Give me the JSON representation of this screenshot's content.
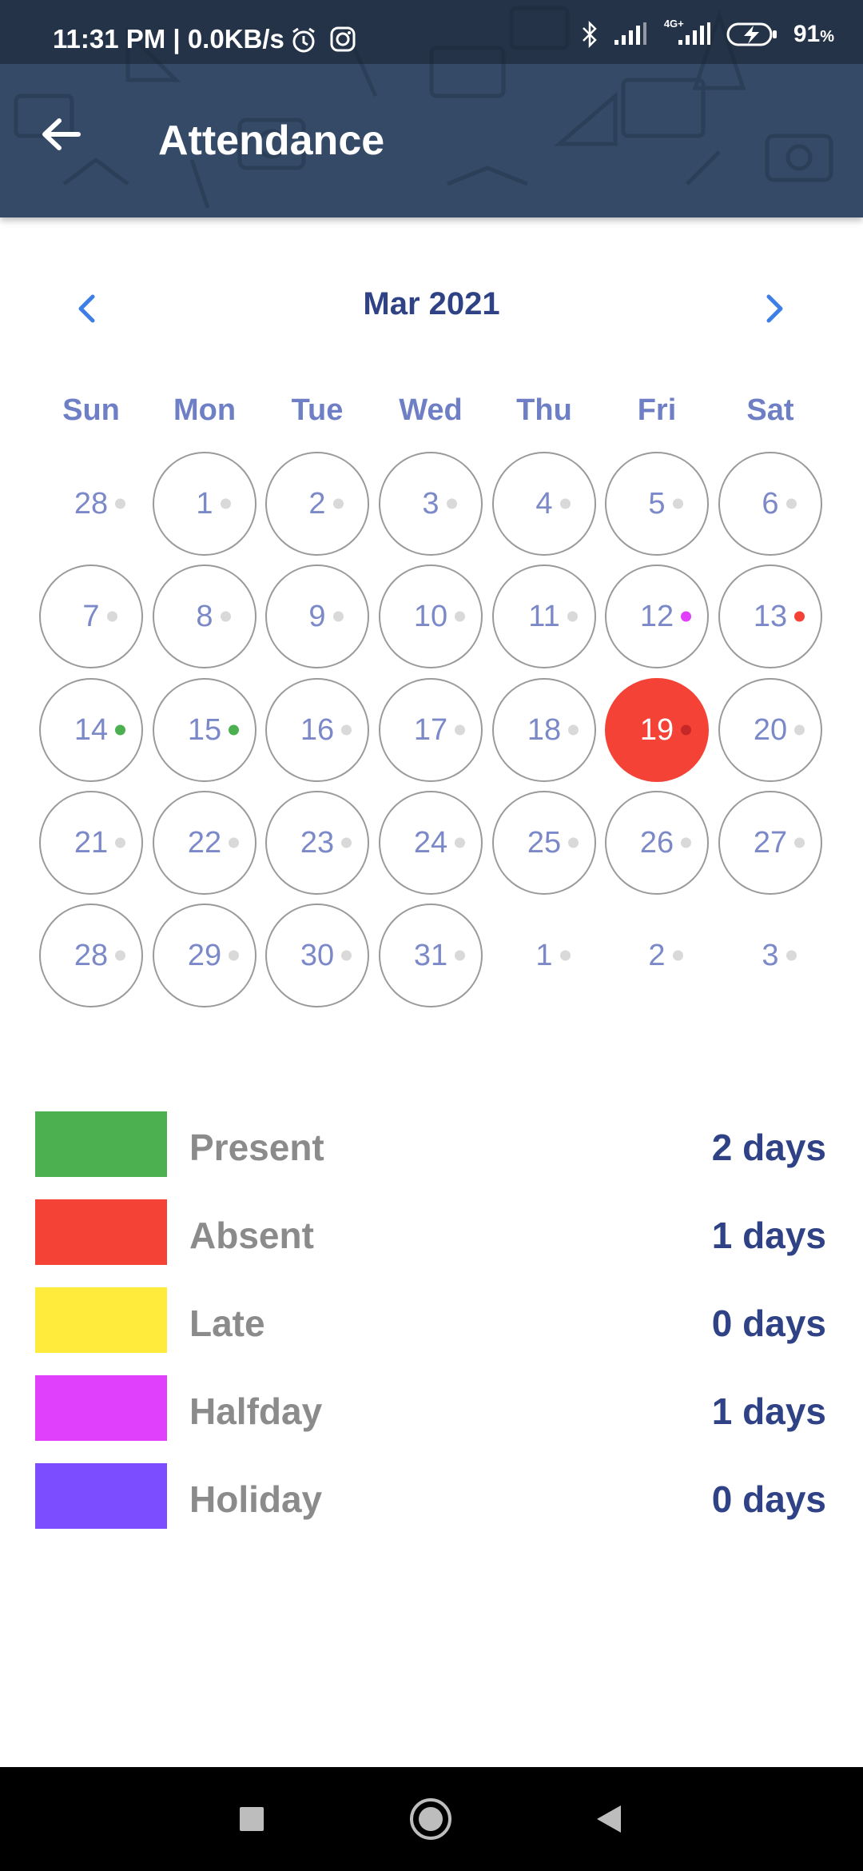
{
  "status_bar": {
    "time": "11:31 PM | 0.0KB/s",
    "battery": "91",
    "battery_unit": "%",
    "network": "4G+",
    "icons": [
      "alarm-icon",
      "instagram-icon",
      "bluetooth-icon",
      "signal-icon",
      "signal-4g-icon",
      "battery-charging-icon"
    ]
  },
  "app_bar": {
    "title": "Attendance",
    "back_icon": "arrow-left-icon",
    "background_color": "#354a66"
  },
  "calendar": {
    "month_label": "Mar 2021",
    "prev_icon": "chevron-left-icon",
    "next_icon": "chevron-right-icon",
    "weekdays": [
      "Sun",
      "Mon",
      "Tue",
      "Wed",
      "Thu",
      "Fri",
      "Sat"
    ],
    "weeks": [
      [
        {
          "day": "28",
          "current_month": false,
          "status": null
        },
        {
          "day": "1",
          "current_month": true,
          "status": null
        },
        {
          "day": "2",
          "current_month": true,
          "status": null
        },
        {
          "day": "3",
          "current_month": true,
          "status": null
        },
        {
          "day": "4",
          "current_month": true,
          "status": null
        },
        {
          "day": "5",
          "current_month": true,
          "status": null
        },
        {
          "day": "6",
          "current_month": true,
          "status": null
        }
      ],
      [
        {
          "day": "7",
          "current_month": true,
          "status": null
        },
        {
          "day": "8",
          "current_month": true,
          "status": null
        },
        {
          "day": "9",
          "current_month": true,
          "status": null
        },
        {
          "day": "10",
          "current_month": true,
          "status": null
        },
        {
          "day": "11",
          "current_month": true,
          "status": null
        },
        {
          "day": "12",
          "current_month": true,
          "status": "halfday"
        },
        {
          "day": "13",
          "current_month": true,
          "status": "absent"
        }
      ],
      [
        {
          "day": "14",
          "current_month": true,
          "status": "present"
        },
        {
          "day": "15",
          "current_month": true,
          "status": "present"
        },
        {
          "day": "16",
          "current_month": true,
          "status": null
        },
        {
          "day": "17",
          "current_month": true,
          "status": null
        },
        {
          "day": "18",
          "current_month": true,
          "status": null
        },
        {
          "day": "19",
          "current_month": true,
          "status": null,
          "selected": true
        },
        {
          "day": "20",
          "current_month": true,
          "status": null
        }
      ],
      [
        {
          "day": "21",
          "current_month": true,
          "status": null
        },
        {
          "day": "22",
          "current_month": true,
          "status": null
        },
        {
          "day": "23",
          "current_month": true,
          "status": null
        },
        {
          "day": "24",
          "current_month": true,
          "status": null
        },
        {
          "day": "25",
          "current_month": true,
          "status": null
        },
        {
          "day": "26",
          "current_month": true,
          "status": null
        },
        {
          "day": "27",
          "current_month": true,
          "status": null
        }
      ],
      [
        {
          "day": "28",
          "current_month": true,
          "status": null
        },
        {
          "day": "29",
          "current_month": true,
          "status": null
        },
        {
          "day": "30",
          "current_month": true,
          "status": null
        },
        {
          "day": "31",
          "current_month": true,
          "status": null
        },
        {
          "day": "1",
          "current_month": false,
          "status": null
        },
        {
          "day": "2",
          "current_month": false,
          "status": null
        },
        {
          "day": "3",
          "current_month": false,
          "status": null
        }
      ]
    ],
    "selected_color": "#f44336",
    "dot_default_color": "#d9d9d9"
  },
  "legend": [
    {
      "key": "present",
      "label": "Present",
      "value": "2 days",
      "color": "#4caf50"
    },
    {
      "key": "absent",
      "label": "Absent",
      "value": "1 days",
      "color": "#f44336"
    },
    {
      "key": "late",
      "label": "Late",
      "value": "0 days",
      "color": "#ffeb3b"
    },
    {
      "key": "halfday",
      "label": "Halfday",
      "value": "1 days",
      "color": "#e040fb"
    },
    {
      "key": "holiday",
      "label": "Holiday",
      "value": "0 days",
      "color": "#7c4dff"
    }
  ],
  "nav_bar": {
    "icons": [
      "recents-square-icon",
      "home-circle-icon",
      "back-triangle-icon"
    ]
  }
}
